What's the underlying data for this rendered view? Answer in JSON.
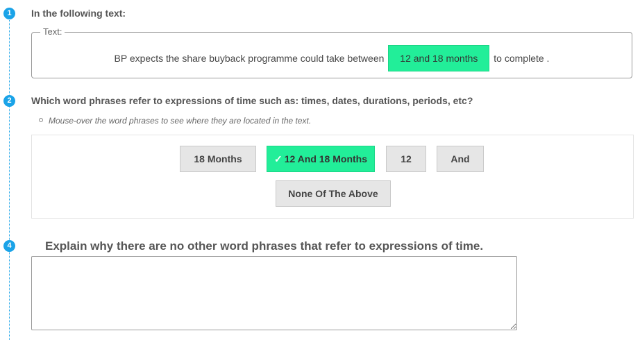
{
  "steps": [
    "1",
    "2",
    "4"
  ],
  "section1": {
    "heading": "In the following text:",
    "legend": "Text:",
    "sentence_before": "BP expects the share buyback programme could take between",
    "highlight": "12 and 18 months",
    "sentence_after": "to complete ."
  },
  "section2": {
    "heading": "Which word phrases refer to expressions of time such as: times, dates, durations, periods, etc?",
    "hint": "Mouse-over the word phrases to see where they are located in the text.",
    "options": [
      {
        "label": "18 Months",
        "selected": false
      },
      {
        "label": "12 And 18 Months",
        "selected": true
      },
      {
        "label": "12",
        "selected": false
      },
      {
        "label": "And",
        "selected": false
      },
      {
        "label": "None Of The Above",
        "selected": false
      }
    ],
    "check_glyph": "✓"
  },
  "section4": {
    "question": "Explain why there are no other word phrases that refer to expressions of time.",
    "answer": ""
  },
  "colors": {
    "accent": "#1aa3e8",
    "selected": "#22ee99"
  }
}
